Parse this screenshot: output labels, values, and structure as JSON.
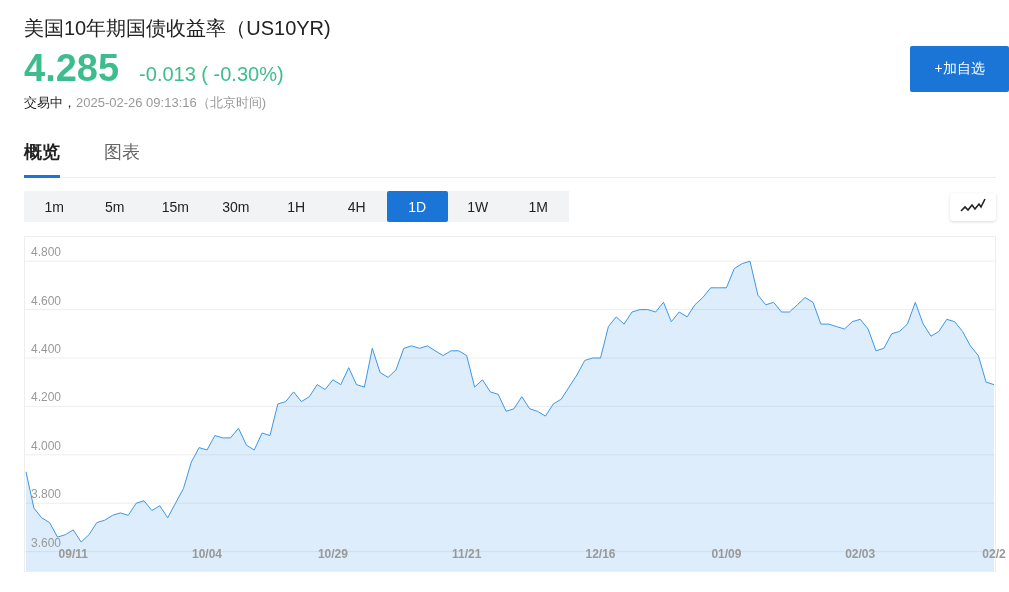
{
  "quote": {
    "title": "美国10年期国债收益率（US10YR)",
    "price": "4.285",
    "change": "-0.013 ( -0.30%)",
    "status": "交易中，",
    "timestamp": "2025-02-26 09:13:16（北京时间)"
  },
  "watch_button": {
    "label": "+加自选"
  },
  "tabs": [
    {
      "label": "概览",
      "selected": true
    },
    {
      "label": "图表",
      "selected": false
    }
  ],
  "intervals": [
    {
      "label": "1m",
      "selected": false
    },
    {
      "label": "5m",
      "selected": false
    },
    {
      "label": "15m",
      "selected": false
    },
    {
      "label": "30m",
      "selected": false
    },
    {
      "label": "1H",
      "selected": false
    },
    {
      "label": "4H",
      "selected": false
    },
    {
      "label": "1D",
      "selected": true
    },
    {
      "label": "1W",
      "selected": false
    },
    {
      "label": "1M",
      "selected": false
    }
  ],
  "chart": {
    "chart_data": {
      "type": "area",
      "ylim": [
        3.52,
        4.9
      ],
      "grid": true,
      "yticks": [
        {
          "value": 3.6,
          "label": "3.600"
        },
        {
          "value": 3.8,
          "label": "3.800"
        },
        {
          "value": 4.0,
          "label": "4.000"
        },
        {
          "value": 4.2,
          "label": "4.200"
        },
        {
          "value": 4.4,
          "label": "4.400"
        },
        {
          "value": 4.6,
          "label": "4.600"
        },
        {
          "value": 4.8,
          "label": "4.800"
        }
      ],
      "categories": [
        null,
        null,
        null,
        null,
        null,
        null,
        "09/11",
        null,
        null,
        null,
        null,
        null,
        null,
        null,
        null,
        null,
        null,
        null,
        null,
        null,
        null,
        null,
        null,
        "10/04",
        null,
        null,
        null,
        null,
        null,
        null,
        null,
        null,
        null,
        null,
        null,
        null,
        null,
        null,
        null,
        "10/29",
        null,
        null,
        null,
        null,
        null,
        null,
        null,
        null,
        null,
        null,
        null,
        null,
        null,
        null,
        null,
        null,
        "11/21",
        null,
        null,
        null,
        null,
        null,
        null,
        null,
        null,
        null,
        null,
        null,
        null,
        null,
        null,
        null,
        null,
        "12/16",
        null,
        null,
        null,
        null,
        null,
        null,
        null,
        null,
        null,
        null,
        null,
        null,
        null,
        null,
        null,
        "01/09",
        null,
        null,
        null,
        null,
        null,
        null,
        null,
        null,
        null,
        null,
        null,
        null,
        null,
        null,
        null,
        null,
        "02/03",
        null,
        null,
        null,
        null,
        null,
        null,
        null,
        null,
        null,
        null,
        null,
        null,
        null,
        null,
        null,
        null,
        "02/2"
      ],
      "series": [
        {
          "color": "#3d97e8",
          "values": [
            3.93,
            3.78,
            3.74,
            3.72,
            3.66,
            3.67,
            3.69,
            3.64,
            3.67,
            3.72,
            3.73,
            3.75,
            3.76,
            3.75,
            3.8,
            3.81,
            3.77,
            3.79,
            3.74,
            3.8,
            3.86,
            3.97,
            4.03,
            4.02,
            4.08,
            4.07,
            4.07,
            4.11,
            4.04,
            4.02,
            4.09,
            4.08,
            4.21,
            4.22,
            4.26,
            4.22,
            4.24,
            4.29,
            4.27,
            4.31,
            4.29,
            4.36,
            4.29,
            4.28,
            4.44,
            4.34,
            4.32,
            4.35,
            4.44,
            4.45,
            4.44,
            4.45,
            4.43,
            4.41,
            4.43,
            4.43,
            4.41,
            4.28,
            4.31,
            4.26,
            4.25,
            4.18,
            4.19,
            4.24,
            4.19,
            4.18,
            4.16,
            4.21,
            4.23,
            4.28,
            4.33,
            4.39,
            4.4,
            4.4,
            4.53,
            4.57,
            4.54,
            4.59,
            4.6,
            4.6,
            4.59,
            4.63,
            4.55,
            4.59,
            4.57,
            4.62,
            4.65,
            4.69,
            4.69,
            4.69,
            4.77,
            4.79,
            4.8,
            4.66,
            4.62,
            4.63,
            4.59,
            4.59,
            4.62,
            4.65,
            4.63,
            4.54,
            4.54,
            4.53,
            4.52,
            4.55,
            4.56,
            4.52,
            4.43,
            4.44,
            4.5,
            4.51,
            4.54,
            4.63,
            4.54,
            4.49,
            4.51,
            4.56,
            4.55,
            4.51,
            4.45,
            4.41,
            4.3,
            4.29
          ]
        }
      ]
    }
  }
}
